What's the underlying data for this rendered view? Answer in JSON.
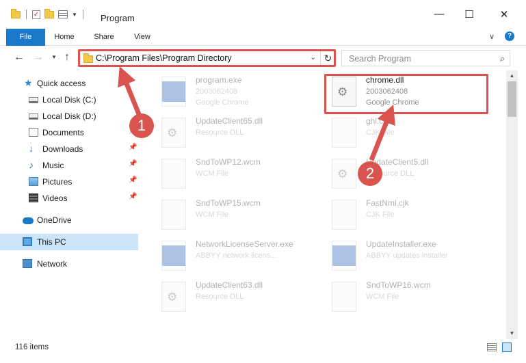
{
  "window": {
    "title": "Program",
    "controls": {
      "minimize": "—",
      "maximize": "☐",
      "close": "✕"
    }
  },
  "ribbon": {
    "tabs": [
      "File",
      "Home",
      "Share",
      "View"
    ],
    "expand_glyph": "∨",
    "help_glyph": "?"
  },
  "nav": {
    "address": "C:\\Program Files\\Program Directory",
    "search_placeholder": "Search Program"
  },
  "sidebar": {
    "items": [
      {
        "label": "Quick access",
        "icon": "star-icon"
      },
      {
        "label": "Local Disk (C:)",
        "icon": "drive-icon"
      },
      {
        "label": "Local Disk (D:)",
        "icon": "drive-icon"
      },
      {
        "label": "Documents",
        "icon": "documents-icon",
        "pinned": true
      },
      {
        "label": "Downloads",
        "icon": "downloads-icon",
        "pinned": true
      },
      {
        "label": "Music",
        "icon": "music-icon",
        "pinned": true
      },
      {
        "label": "Pictures",
        "icon": "pictures-icon",
        "pinned": true
      },
      {
        "label": "Videos",
        "icon": "videos-icon",
        "pinned": true
      },
      {
        "label": "OneDrive",
        "icon": "onedrive-icon"
      },
      {
        "label": "This PC",
        "icon": "this-pc-icon",
        "selected": true
      },
      {
        "label": "Network",
        "icon": "network-icon"
      }
    ]
  },
  "files": [
    {
      "name": "program.exe",
      "line2": "2003062408",
      "line3": "Google Chrome",
      "icon": "exe-icon",
      "highlighted": false
    },
    {
      "name": "chrome.dll",
      "line2": "2003062408",
      "line3": "Google Chrome",
      "icon": "dll-gear-icon",
      "highlighted": true
    },
    {
      "name": "UpdateClient65.dll",
      "line2": "Resource DLL",
      "line3": "",
      "icon": "dll-gear-icon",
      "highlighted": false
    },
    {
      "name": "ghl.cjk",
      "line2": "CJK File",
      "line3": "",
      "icon": "file-icon",
      "highlighted": false
    },
    {
      "name": "SndToWP12.wcm",
      "line2": "WCM File",
      "line3": "",
      "icon": "file-icon",
      "highlighted": false
    },
    {
      "name": "UpdateClient5.dll",
      "line2": "Resource DLL",
      "line3": "",
      "icon": "dll-gear-icon",
      "highlighted": false
    },
    {
      "name": "SndToWP15.wcm",
      "line2": "WCM File",
      "line3": "",
      "icon": "file-icon",
      "highlighted": false
    },
    {
      "name": "FastNml.cjk",
      "line2": "CJK File",
      "line3": "",
      "icon": "file-icon",
      "highlighted": false
    },
    {
      "name": "NetworkLicenseServer.exe",
      "line2": "ABBYY network licens...",
      "line3": "",
      "icon": "exe-icon",
      "highlighted": false
    },
    {
      "name": "UpdateInstaller.exe",
      "line2": "ABBYY updates installer",
      "line3": "",
      "icon": "exe-icon",
      "highlighted": false
    },
    {
      "name": "UpdateClient63.dll",
      "line2": "Resource DLL",
      "line3": "",
      "icon": "dll-gear-icon",
      "highlighted": false
    },
    {
      "name": "SndToWP16.wcm",
      "line2": "WCM File",
      "line3": "",
      "icon": "file-icon",
      "highlighted": false
    }
  ],
  "status": {
    "item_count": "116 items"
  },
  "callouts": [
    "1",
    "2"
  ],
  "colors": {
    "accent": "#1979ca",
    "callout_red": "#d9534f",
    "selected_bg": "#cce4f7"
  }
}
